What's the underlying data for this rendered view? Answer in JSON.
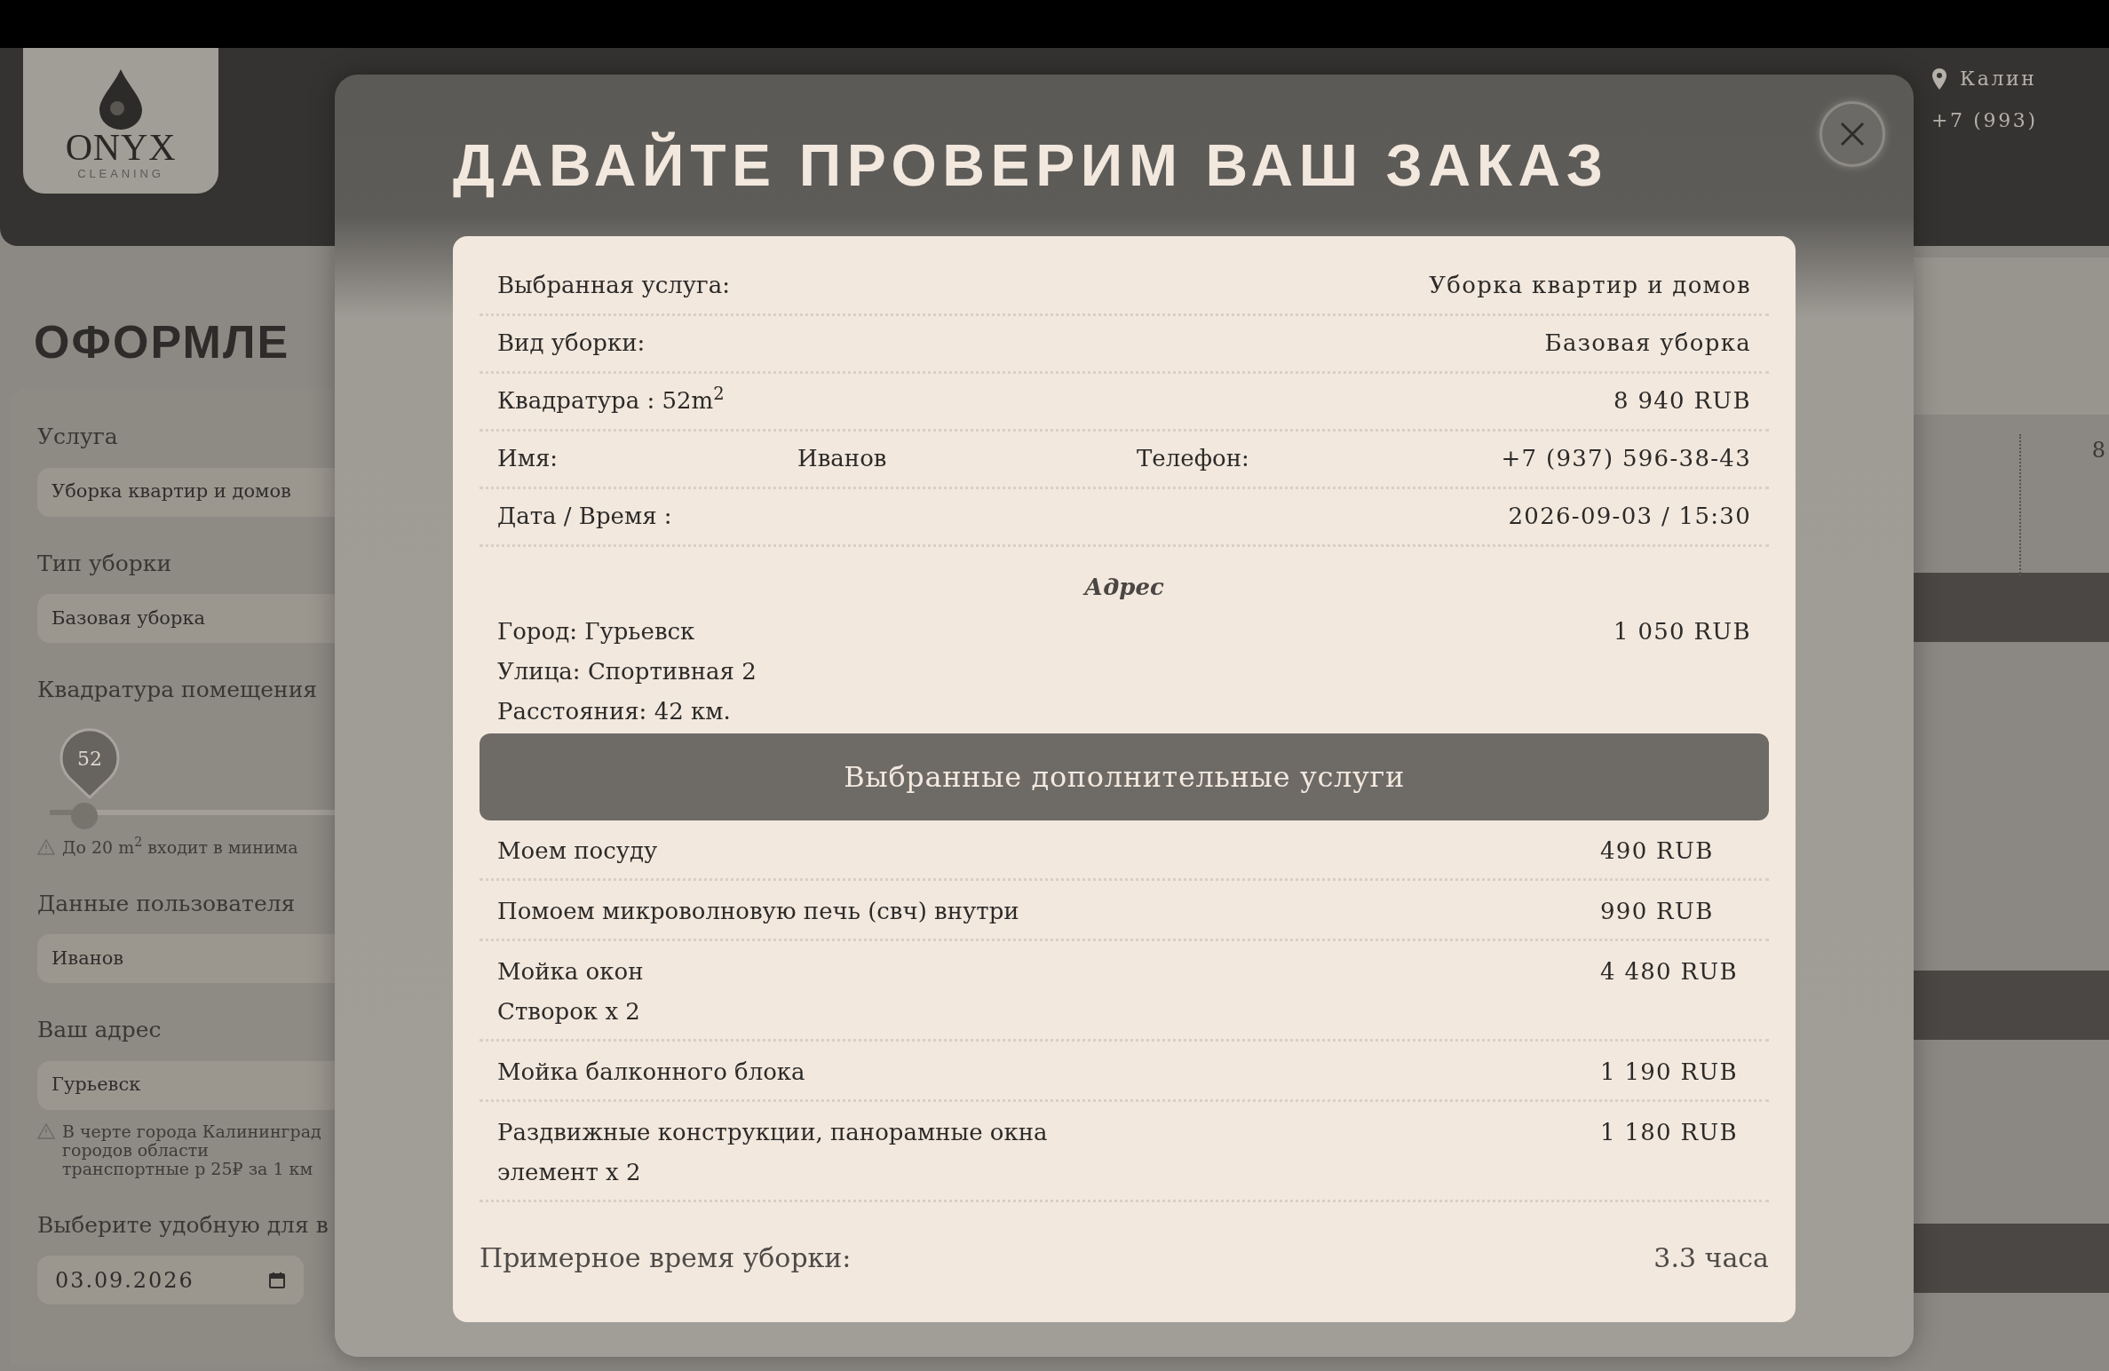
{
  "header": {
    "logo": {
      "wordmark": "ONYX",
      "tagline": "CLEANING"
    },
    "location": "Калин",
    "phone": "+7 (993)"
  },
  "page": {
    "title": "ОФОРМЛЕ",
    "form": [
      {
        "kind": "label",
        "text": "Услуга"
      },
      {
        "kind": "field",
        "value": "Уборка квартир и домов"
      },
      {
        "kind": "label",
        "text": "Тип уборки"
      },
      {
        "kind": "field",
        "value": "Базовая уборка"
      },
      {
        "kind": "label",
        "text": "Квадратура помещения"
      },
      {
        "kind": "slider",
        "bubble": "52",
        "level": 0.13
      },
      {
        "kind": "note",
        "text": "До 20 m$^{2}$ входит в минима"
      },
      {
        "kind": "label",
        "text": "Данные пользователя"
      },
      {
        "kind": "field",
        "value": "Иванов"
      },
      {
        "kind": "label",
        "text": "Ваш адрес"
      },
      {
        "kind": "field",
        "value": "Гурьевск"
      },
      {
        "kind": "note",
        "text": "В черте города Калининград городов области транспортные р 25₽ за 1 км"
      },
      {
        "kind": "label",
        "text": "Выберите удобную для в"
      },
      {
        "kind": "date",
        "value": "03.09.2026"
      }
    ],
    "side_value": "8"
  },
  "modal": {
    "title": "ДАВАЙТЕ ПРОВЕРИМ ВАШ ЗАКАЗ",
    "summary": [
      {
        "kind": "pair",
        "label": "Выбранная услуга:",
        "value": "Уборка квартир и домов"
      },
      {
        "kind": "pair",
        "label": "Вид уборки:",
        "value": "Базовая уборка"
      },
      {
        "kind": "pair",
        "label": "Квадратура : 52m$^{2}$",
        "value": "8 940 RUB"
      },
      {
        "kind": "double",
        "label": "Имя:",
        "value": "Иванов",
        "label_2": "Телефон:",
        "value_2": "+7 (937) 596-38-43"
      },
      {
        "kind": "pair",
        "label": "Дата / Время :",
        "value": "2026-09-03 / 15:30"
      }
    ],
    "address": {
      "title": "Адрес",
      "lines": [
        "Город: Гурьевск",
        "Улица: Спортивная 2",
        "Расстояния: 42 км."
      ],
      "price": "1 050 RUB"
    },
    "extras": {
      "title": "Выбранные дополнительные услуги",
      "items": [
        {
          "lines": [
            "Моем посуду"
          ],
          "price": "490 RUB"
        },
        {
          "lines": [
            "Помоем микроволновую печь (свч) внутри"
          ],
          "price": "990 RUB"
        },
        {
          "lines": [
            "Мойка окон",
            "Створок x 2"
          ],
          "price": "4 480 RUB"
        },
        {
          "lines": [
            "Мойка балконного блока"
          ],
          "price": "1 190 RUB"
        },
        {
          "lines": [
            "Раздвижные конструкции, панорамные окна",
            "элемент x 2"
          ],
          "price": "1 180 RUB"
        }
      ]
    },
    "estimate": {
      "label": "Примерное время уборки:",
      "value": "3.3 часа"
    }
  }
}
